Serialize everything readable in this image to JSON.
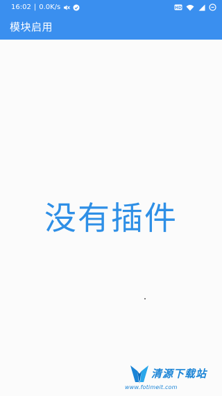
{
  "status_bar": {
    "time": "16:02",
    "separator": "|",
    "speed": "0.0K/s",
    "icons_left": [
      "mute-icon",
      "app-notification-icon"
    ],
    "icons_right": [
      "hd-icon",
      "wifi-icon",
      "signal-icon",
      "battery-icon"
    ],
    "hd_label": "HD"
  },
  "toolbar": {
    "title": "模块启用"
  },
  "main": {
    "empty_message": "没有插件"
  },
  "watermark": {
    "name": "清源下载站",
    "url": "www.fotimeit.com"
  },
  "colors": {
    "primary": "#3a8fef",
    "empty_text": "#2e8fe6",
    "background": "#fbfbfb",
    "watermark": "#1b84d6"
  }
}
